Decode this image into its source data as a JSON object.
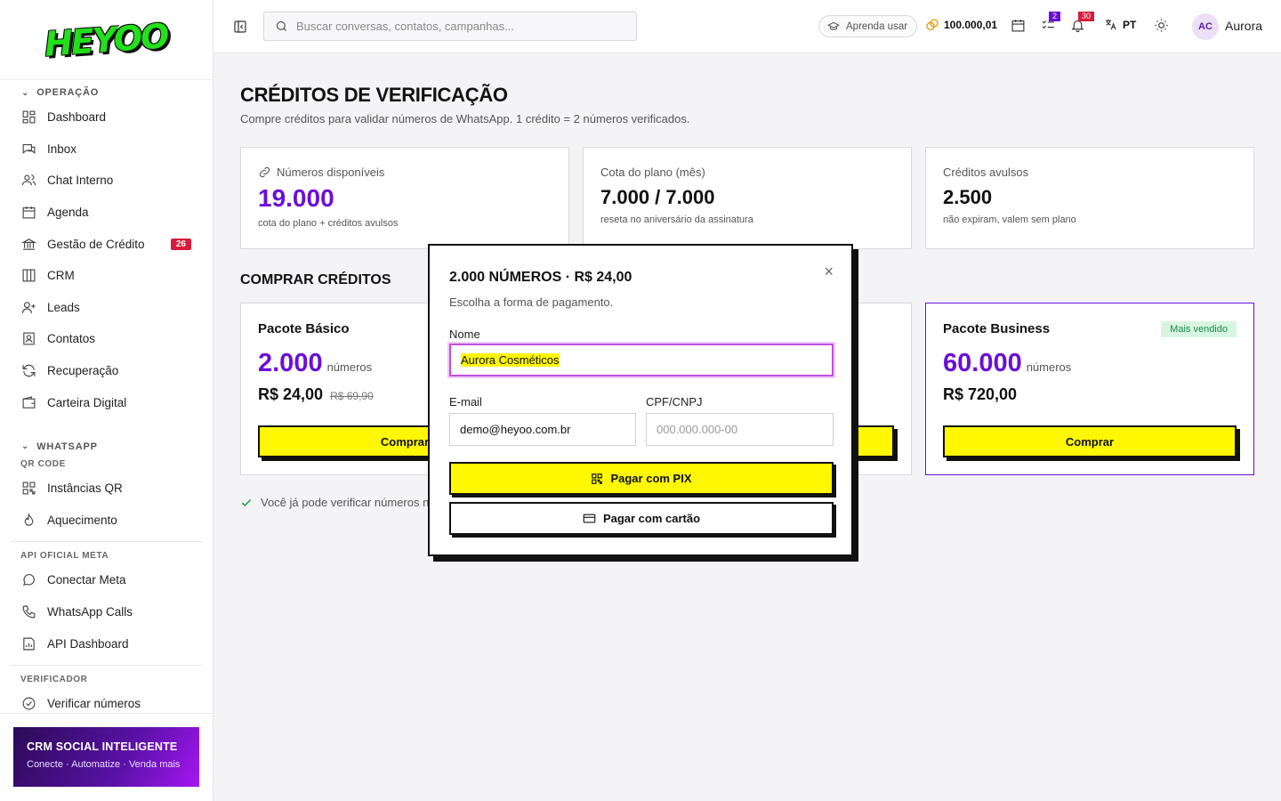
{
  "brand": {
    "logo_text": "HEYOO",
    "logo_color": "#22e01a"
  },
  "sidebar": {
    "sections": {
      "operacao": "OPERAÇÃO",
      "whatsapp": "WHATSAPP",
      "qr_code": "QR CODE",
      "api_meta": "API OFICIAL META",
      "verificador": "VERIFICADOR"
    },
    "items": {
      "dashboard": "Dashboard",
      "inbox": "Inbox",
      "chat_interno": "Chat Interno",
      "agenda": "Agenda",
      "gestao_credito": "Gestão de Crédito",
      "gestao_credito_badge": "26",
      "crm": "CRM",
      "leads": "Leads",
      "contatos": "Contatos",
      "recuperacao": "Recuperação",
      "carteira": "Carteira Digital",
      "instancias_qr": "Instâncias QR",
      "aquecimento": "Aquecimento",
      "conectar_meta": "Conectar Meta",
      "whatsapp_calls": "WhatsApp Calls",
      "api_dashboard": "API Dashboard",
      "verificar": "Verificar números"
    },
    "promo": {
      "title": "CRM SOCIAL INTELIGENTE",
      "subtitle": "Conecte · Automatize · Venda mais"
    }
  },
  "topbar": {
    "search_placeholder": "Buscar conversas, contatos, campanhas...",
    "learn_label": "Aprenda usar",
    "credits": "100.000,01",
    "tasks_badge": "2",
    "notif_badge": "30",
    "lang": "PT",
    "avatar_initials": "AC",
    "username": "Aurora"
  },
  "page": {
    "title": "CRÉDITOS DE VERIFICAÇÃO",
    "subtitle": "Compre créditos para validar números de WhatsApp. 1 crédito = 2 números verificados.",
    "stats": [
      {
        "label": "Números disponíveis",
        "value": "19.000",
        "hint": "cota do plano + créditos avulsos"
      },
      {
        "label": "Cota do plano (mês)",
        "value": "7.000 / 7.000",
        "hint": "reseta no aniversário da assinatura"
      },
      {
        "label": "Créditos avulsos",
        "value": "2.500",
        "hint": "não expiram, valem sem plano"
      }
    ],
    "buy_section_title": "COMPRAR CRÉDITOS",
    "packs": [
      {
        "name": "Pacote Básico",
        "qty": "2.000",
        "unit": "números",
        "price": "R$ 24,00",
        "old_price": "R$ 69,90",
        "button": "Comprar"
      },
      {
        "name": "Pacote Business",
        "tag": "Mais vendido",
        "qty": "60.000",
        "unit": "números",
        "price": "R$ 720,00",
        "button": "Comprar"
      }
    ],
    "notice": "Você já pode verificar números na"
  },
  "modal": {
    "title": "2.000 NÚMEROS · R$ 24,00",
    "subtitle": "Escolha a forma de pagamento.",
    "name_label": "Nome",
    "name_value": "Aurora Cosméticos",
    "email_label": "E-mail",
    "email_value": "demo@heyoo.com.br",
    "doc_label": "CPF/CNPJ",
    "doc_placeholder": "000.000.000-00",
    "pix_button": "Pagar com PIX",
    "card_button": "Pagar com cartão",
    "close_symbol": "×"
  },
  "colors": {
    "accent_purple": "#6a0fd8",
    "yellow": "#fff800",
    "badge_red": "#d81b3a"
  }
}
